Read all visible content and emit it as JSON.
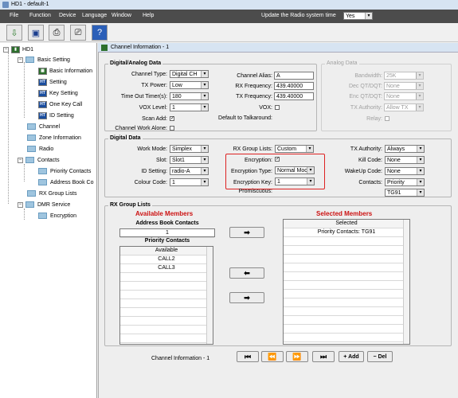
{
  "window": {
    "title": "HD1 - default-1"
  },
  "menu": {
    "file": "File",
    "function": "Function",
    "device": "Device",
    "language": "Language",
    "window": "Window",
    "help": "Help",
    "update_label": "Update the Radio system time",
    "update_value": "Yes"
  },
  "tree": {
    "root": "HD1",
    "basic_setting": "Basic Setting",
    "basic_information": "Basic Information",
    "setting": "Setting",
    "key_setting": "Key Setting",
    "one_key_call": "One Key Call",
    "id_setting": "ID Setting",
    "channel": "Channel",
    "zone_information": "Zone Information",
    "radio": "Radio",
    "contacts": "Contacts",
    "priority_contacts": "Priority Contacts",
    "address_book": "Address Book Co",
    "rx_group_lists": "RX Group Lists",
    "dmr_service": "DMR Service",
    "encryption": "Encryption"
  },
  "panel": {
    "title": "Channel Information - 1"
  },
  "digital_analog": {
    "title": "Digital/Analog Data",
    "channel_type_label": "Channel Type:",
    "channel_type": "Digital CH",
    "tx_power_label": "TX Power:",
    "tx_power": "Low",
    "time_out_label": "Time Out Timer(s):",
    "time_out": "180",
    "vox_level_label": "VOX Level:",
    "vox_level": "1",
    "scan_add_label": "Scan Add:",
    "channel_work_alone_label": "Channel Work Alone:",
    "channel_alias_label": "Channel Alias:",
    "channel_alias": "A",
    "rx_freq_label": "RX Frequency:",
    "rx_freq": "439.40000",
    "tx_freq_label": "TX Frequency:",
    "tx_freq": "439.40000",
    "vox_label": "VOX:",
    "default_talkaround_label": "Default to Talkaround:"
  },
  "analog": {
    "title": "Analog Data",
    "bandwidth_label": "Bandwidth:",
    "bandwidth": "25K",
    "dec_label": "Dec QT/DQT:",
    "dec": "None",
    "enc_label": "Enc QT/DQT:",
    "enc": "None",
    "tx_authority_label": "TX Authority:",
    "tx_authority": "Allow TX",
    "relay_label": "Relay:"
  },
  "digital": {
    "title": "Digital Data",
    "work_mode_label": "Work Mode:",
    "work_mode": "Simplex",
    "slot_label": "Slot:",
    "slot": "Slot1",
    "id_setting_label": "ID Setting:",
    "id_setting": "radio-A",
    "colour_code_label": "Colour Code:",
    "colour_code": "1",
    "rx_group_label": "RX Group Lists:",
    "rx_group": "Custom",
    "encryption_label": "Encryption:",
    "encryption_type_label": "Encryption Type:",
    "encryption_type": "Normal Moc",
    "encryption_key_label": "Encryption Key:",
    "encryption_key": "1",
    "promiscuous_label": "Promiscuous:",
    "tx_authority_label": "TX Authority:",
    "tx_authority": "Always",
    "kill_code_label": "Kill Code:",
    "kill_code": "None",
    "wakeup_code_label": "WakeUp Code:",
    "wakeup_code": "None",
    "contacts_label": "Contacts:",
    "contacts": "Priority",
    "contacts_sub": "TG91"
  },
  "rx_lists": {
    "title": "RX Group Lists",
    "available_members": "Available Members",
    "selected_members": "Selected Members",
    "address_book_contacts": "Address Book Contacts",
    "address_book_value": "1",
    "priority_contacts": "Priority Contacts",
    "available_header": "Available",
    "available_items": [
      "CALL2",
      "CALL3"
    ],
    "selected_header": "Selected",
    "selected_items": [
      "Priority Contacts: TG91"
    ]
  },
  "nav": {
    "label": "Channel Information - 1",
    "add": "+ Add",
    "del": "− Del"
  },
  "colors": {
    "highlight_box": "#dd2222",
    "member_heading": "#cc1111"
  }
}
